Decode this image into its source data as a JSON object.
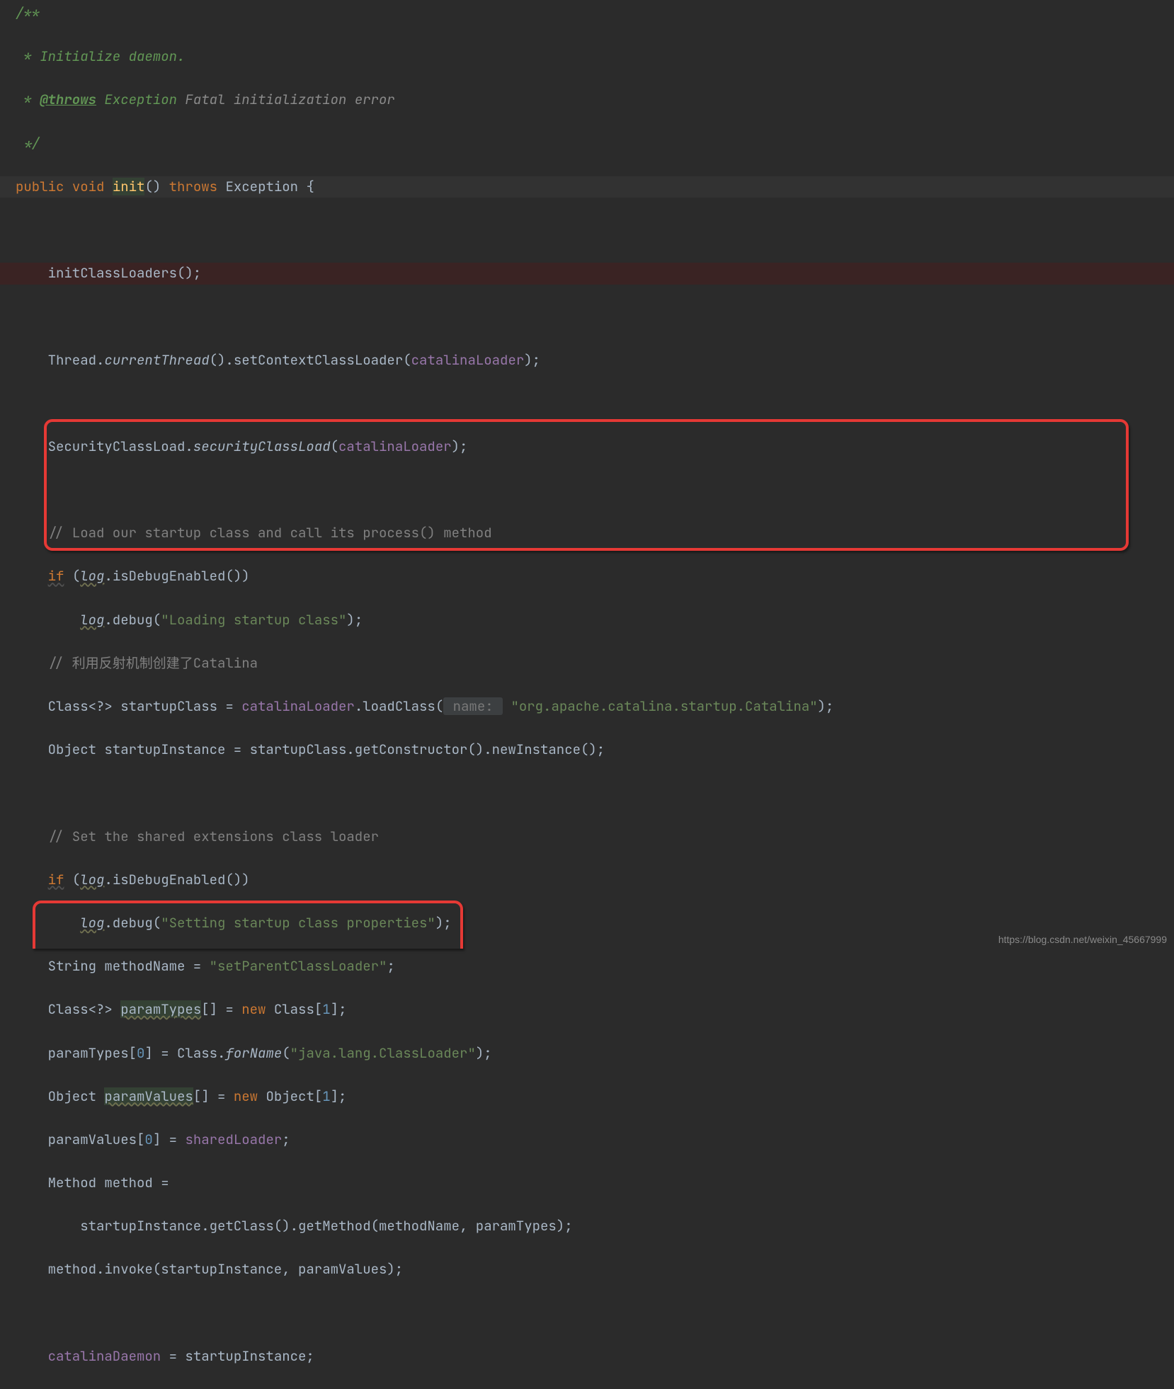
{
  "code": {
    "l1": "/**",
    "l2": " * Initialize daemon.",
    "l3_a": " * ",
    "l3_tag": "@throws",
    "l3_b": " Exception ",
    "l3_c": "Fatal initialization error",
    "l4": " */",
    "l5_public": "public",
    "l5_void": "void",
    "l5_init": "init",
    "l5_paren": "()",
    "l5_throws": "throws",
    "l5_exc": "Exception {",
    "l7": "initClassLoaders();",
    "l9_a": "Thread.",
    "l9_b": "currentThread",
    "l9_c": "().setContextClassLoader(",
    "l9_d": "catalinaLoader",
    "l9_e": ");",
    "l11_a": "SecurityClassLoad.",
    "l11_b": "securityClassLoad",
    "l11_c": "(",
    "l11_d": "catalinaLoader",
    "l11_e": ");",
    "l13": "// Load our startup class and call its process() method",
    "l14_if": "if",
    "l14_a": " (",
    "l14_log": "log",
    "l14_b": ".isDebugEnabled())",
    "l15_log": "log",
    "l15_a": ".debug(",
    "l15_str": "\"Loading startup class\"",
    "l15_b": ");",
    "l16": "// 利用反射机制创建了Catalina",
    "l17_a": "Class<?> startupClass = ",
    "l17_b": "catalinaLoader",
    "l17_c": ".loadClass(",
    "l17_hint": " name: ",
    "l17_str": "\"org.apache.catalina.startup.Catalina\"",
    "l17_d": ");",
    "l18": "Object startupInstance = startupClass.getConstructor().newInstance();",
    "l20": "// Set the shared extensions class loader",
    "l21_if": "if",
    "l21_a": " (",
    "l21_log": "log",
    "l21_b": ".isDebugEnabled())",
    "l22_log": "log",
    "l22_a": ".debug(",
    "l22_str": "\"Setting startup class properties\"",
    "l22_b": ");",
    "l23_a": "String methodName = ",
    "l23_str": "\"setParentClassLoader\"",
    "l23_b": ";",
    "l24_a": "Class<?> ",
    "l24_b": "paramTypes",
    "l24_c": "[] = ",
    "l24_new": "new",
    "l24_d": " Class[",
    "l24_n": "1",
    "l24_e": "];",
    "l25_a": "paramTypes[",
    "l25_n": "0",
    "l25_b": "] = Class.",
    "l25_c": "forName",
    "l25_d": "(",
    "l25_str": "\"java.lang.ClassLoader\"",
    "l25_e": ");",
    "l26_a": "Object ",
    "l26_b": "paramValues",
    "l26_c": "[] = ",
    "l26_new": "new",
    "l26_d": " Object[",
    "l26_n": "1",
    "l26_e": "];",
    "l27_a": "paramValues[",
    "l27_n": "0",
    "l27_b": "] = ",
    "l27_c": "sharedLoader",
    "l27_d": ";",
    "l28": "Method method =",
    "l29": "startupInstance.getClass().getMethod(methodName, paramTypes);",
    "l30": "method.invoke(startupInstance, paramValues);",
    "l32_a": "catalinaDaemon",
    "l32_b": " = startupInstance;"
  },
  "watermark": "https://blog.csdn.net/weixin_45667999"
}
